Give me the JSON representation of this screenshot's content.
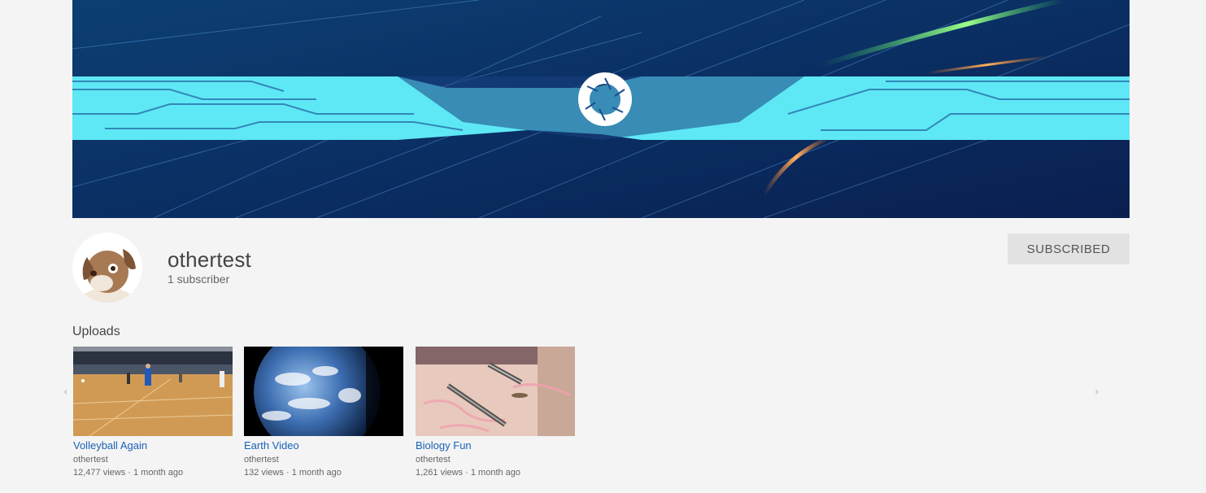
{
  "channel": {
    "name": "othertest",
    "subscriber_count": "1 subscriber",
    "subscribe_button_label": "SUBSCRIBED"
  },
  "uploads": {
    "section_title": "Uploads",
    "prev_arrow": "‹",
    "next_arrow": "›",
    "videos": [
      {
        "title": "Volleyball Again",
        "owner": "othertest",
        "views": "12,477 views",
        "age": "1 month ago"
      },
      {
        "title": "Earth Video",
        "owner": "othertest",
        "views": "132 views",
        "age": "1 month ago"
      },
      {
        "title": "Biology Fun",
        "owner": "othertest",
        "views": "1,261 views",
        "age": "1 month ago"
      }
    ]
  },
  "icons": {
    "avatar": "dog-avatar-icon",
    "banner_logo": "aperture-logo-icon"
  },
  "colors": {
    "link_blue": "#1a62b7",
    "button_gray": "#e2e2e2",
    "background": "#f4f4f4"
  }
}
